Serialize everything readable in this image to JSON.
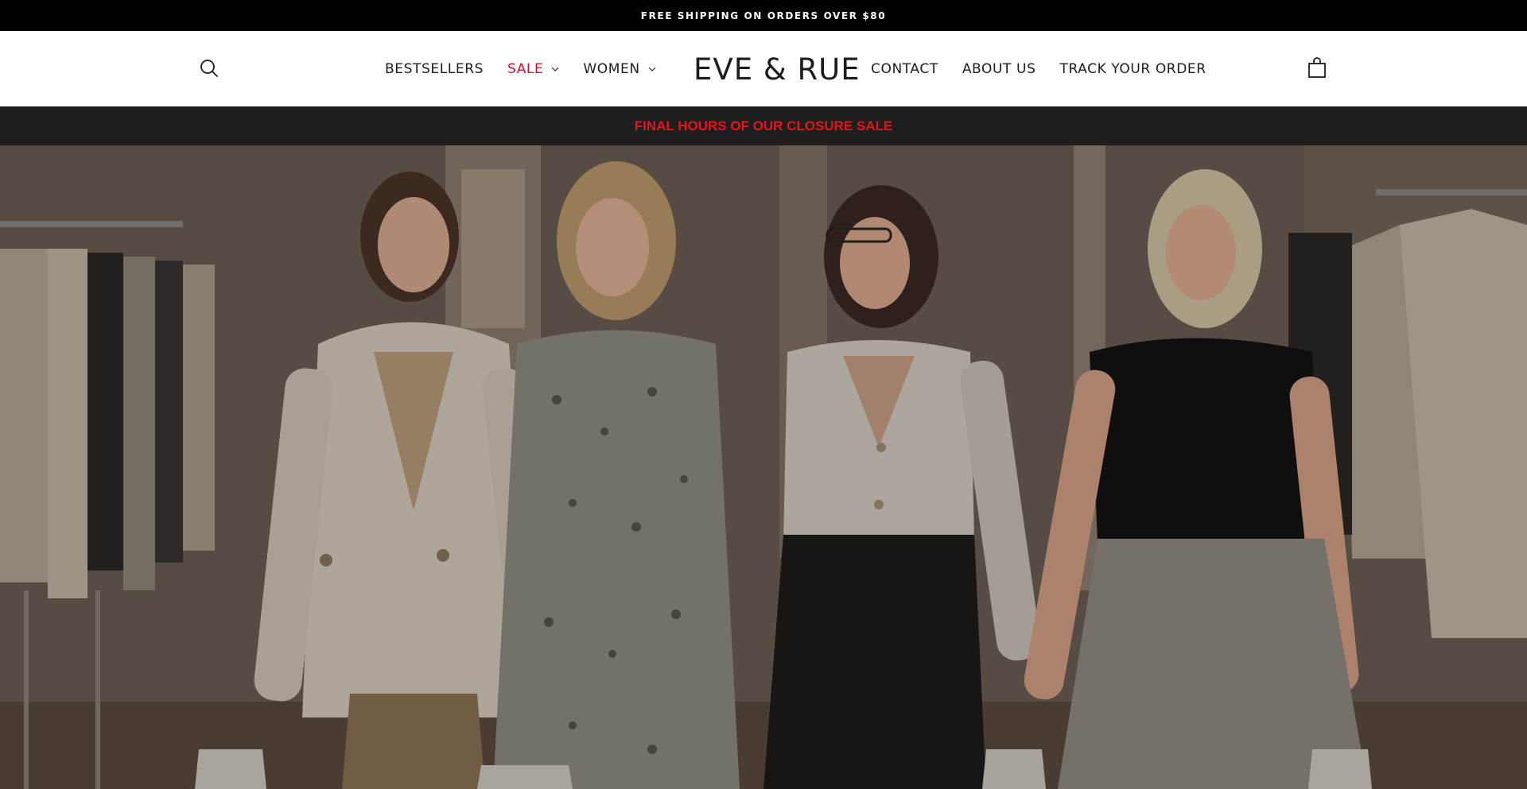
{
  "announcement": {
    "text": "FREE SHIPPING ON ORDERS OVER $80"
  },
  "header": {
    "logo": "EVE & RUE",
    "search_icon": "search-icon",
    "cart_icon": "shopping-bag-icon",
    "nav_left": [
      {
        "label": "BESTSELLERS",
        "dropdown": false
      },
      {
        "label": "SALE",
        "dropdown": true,
        "color": "#c8102e"
      },
      {
        "label": "WOMEN",
        "dropdown": true
      }
    ],
    "nav_right": [
      {
        "label": "CONTACT"
      },
      {
        "label": "ABOUT US"
      },
      {
        "label": "TRACK YOUR ORDER"
      }
    ]
  },
  "promo_bar": {
    "text": "FINAL HOURS OF OUR CLOSURE SALE",
    "color": "#e4151c"
  },
  "colors": {
    "announcement_bg": "#000000",
    "promo_bg": "#1e1e1e",
    "sale": "#c8102e"
  }
}
